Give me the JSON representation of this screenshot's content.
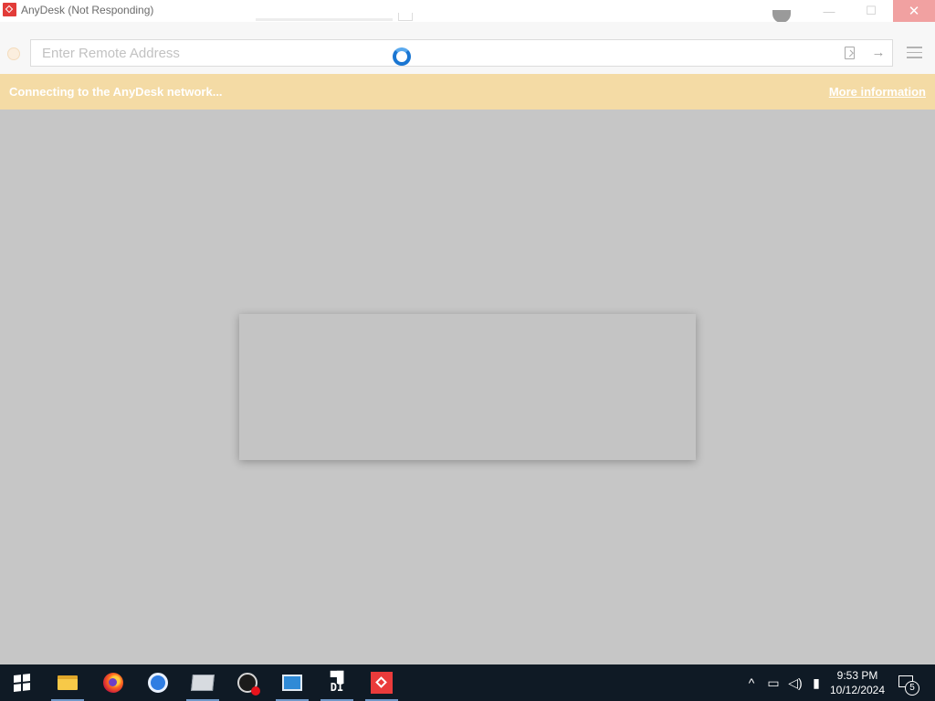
{
  "window": {
    "title": "AnyDesk (Not Responding)",
    "minimize_glyph": "—",
    "maximize_glyph": "☐",
    "close_glyph": "✕"
  },
  "address_bar": {
    "placeholder": "Enter Remote Address",
    "value": "",
    "connect_arrow": "→"
  },
  "banner": {
    "message": "Connecting to the AnyDesk network...",
    "link": "More information"
  },
  "taskbar": {
    "apps": [
      {
        "name": "start",
        "icon": "windows-icon"
      },
      {
        "name": "file-explorer",
        "icon": "folder-icon"
      },
      {
        "name": "firefox",
        "icon": "firefox-icon"
      },
      {
        "name": "chromium",
        "icon": "chrome-icon"
      },
      {
        "name": "explorer-window",
        "icon": "window-folder-icon"
      },
      {
        "name": "clock-app",
        "icon": "clock-icon"
      },
      {
        "name": "control-panel",
        "icon": "control-panel-icon"
      },
      {
        "name": "di-app",
        "icon": "di-icon",
        "label": "DI"
      },
      {
        "name": "anydesk",
        "icon": "anydesk-icon"
      }
    ],
    "tray": {
      "chevron": "^",
      "network": "network-icon",
      "volume": "volume-icon",
      "mic": "microphone-icon"
    },
    "time": "9:53 PM",
    "date": "10/12/2024",
    "notification_count": "5"
  },
  "colors": {
    "banner": "#f4dba5",
    "overlay": "#c6c6c6",
    "close_button": "#f1a1a1",
    "taskbar": "#0f1a25",
    "spinner": "#1a76d2"
  }
}
